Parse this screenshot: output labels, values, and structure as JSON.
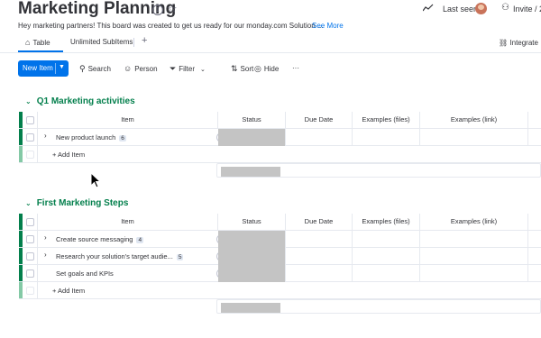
{
  "header": {
    "title": "Marketing Planning",
    "last_seen": "Last seen",
    "invite": "Invite / 2",
    "description": "Hey marketing partners! This board was created to get us ready for our monday.com Solution ...",
    "see_more": "See More"
  },
  "tabs": {
    "table": "Table",
    "unlimited": "Unlimited SubItems",
    "add": "+",
    "integrate": "Integrate"
  },
  "toolbar": {
    "new_item": "New Item",
    "search": "Search",
    "person": "Person",
    "filter": "Filter",
    "sort": "Sort",
    "hide": "Hide",
    "more": "···"
  },
  "columns": [
    "Item",
    "Status",
    "Due Date",
    "Examples (files)",
    "Examples (link)"
  ],
  "groups": [
    {
      "title": "Q1 Marketing activities",
      "color": "#037f4c",
      "items": [
        {
          "name": "New product launch",
          "subitems": "6",
          "expandable": true
        }
      ],
      "add_item": "+ Add Item"
    },
    {
      "title": "First Marketing Steps",
      "color": "#037f4c",
      "items": [
        {
          "name": "Create source messaging",
          "subitems": "4",
          "expandable": true
        },
        {
          "name": "Research your solution's target audie...",
          "subitems": "5",
          "expandable": true
        },
        {
          "name": "Set goals and KPIs",
          "subitems": "",
          "expandable": false
        }
      ],
      "add_item": "+ Add Item"
    }
  ],
  "icons": {
    "info": "info-icon",
    "star": "star-icon",
    "activity": "activity-icon",
    "avatar": "avatar",
    "invite": "add-person-icon",
    "home": "home-icon",
    "integrate": "integrate-icon",
    "search": "search-icon",
    "person": "person-icon",
    "filter": "filter-icon",
    "sort": "sort-icon",
    "hide": "eye-off-icon",
    "chevron": "chevron-down-icon",
    "expand": "chevron-right-icon",
    "conversation": "add-update-icon",
    "cursor": "mouse-cursor"
  },
  "colors": {
    "accent": "#0073ea",
    "group_green": "#037f4c",
    "status_empty": "#c4c4c4"
  }
}
